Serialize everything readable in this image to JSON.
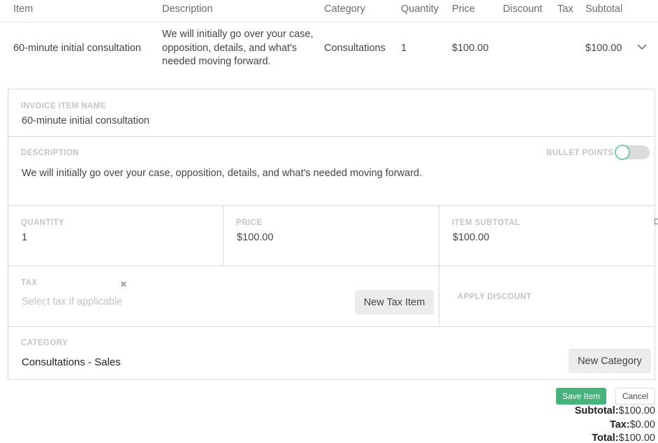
{
  "table": {
    "headers": [
      "Item",
      "Description",
      "Category",
      "Quantity",
      "Price",
      "Discount",
      "Tax",
      "Subtotal"
    ],
    "row": {
      "item": "60-minute initial consultation",
      "description_lines": [
        "We will initially go over your case,",
        "opposition, details, and what's",
        "needed moving forward."
      ],
      "category": "Consultations",
      "quantity": "1",
      "price": "$100.00",
      "discount": "",
      "tax": "",
      "subtotal": "$100.00"
    }
  },
  "form": {
    "item_name": {
      "label": "INVOICE ITEM NAME",
      "value": "60-minute initial consultation"
    },
    "description": {
      "label": "DESCRIPTION",
      "value": "We will initially go over your case, opposition, details, and what's needed moving forward.",
      "bullet_points_label": "BULLET POINTS",
      "bullet_points_on": false
    },
    "quantity": {
      "label": "QUANTITY",
      "value": "1"
    },
    "price": {
      "label": "PRICE",
      "value": "$100.00"
    },
    "item_subtotal": {
      "label": "ITEM SUBTOTAL",
      "value": "$100.00"
    },
    "tax": {
      "label": "TAX",
      "placeholder": "Select tax if applicable",
      "new_button": "New Tax Item"
    },
    "discount": {
      "label": "APPLY DISCOUNT"
    },
    "category": {
      "label": "CATEGORY",
      "value": "Consultations - Sales",
      "new_button": "New Category"
    }
  },
  "actions": {
    "save": "Save Item",
    "cancel": "Cancel"
  },
  "totals": {
    "subtotal_label": "Subtotal:",
    "subtotal": "$100.00",
    "tax_label": "Tax:",
    "tax": "$0.00",
    "total_label": "Total:",
    "total": "$100.00"
  },
  "colors": {
    "accent": "#48b27d",
    "label": "#c4c4c4",
    "border": "#d9d9d9"
  },
  "icons": {
    "expand": "chevron-down-icon",
    "clear": "close-icon"
  }
}
